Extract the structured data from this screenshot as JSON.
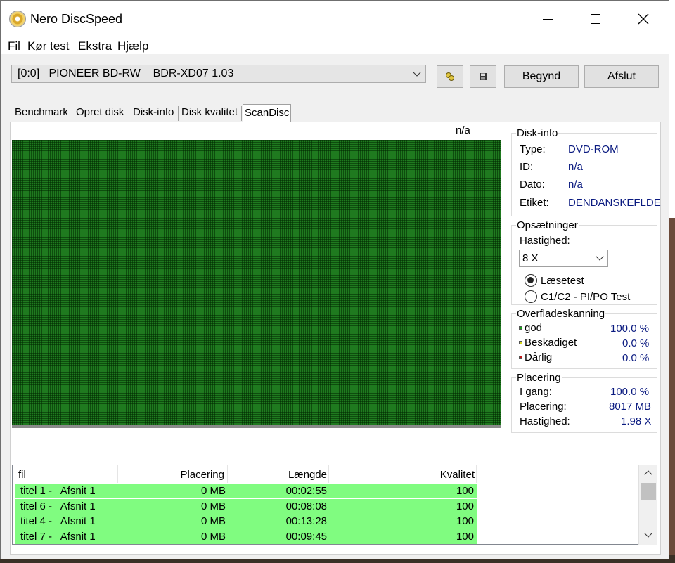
{
  "window": {
    "title": "Nero DiscSpeed",
    "controls": {
      "minimize": "minimize-icon",
      "maximize": "maximize-icon",
      "close": "close-icon"
    }
  },
  "menu": [
    "Fil",
    "Kør test",
    "Ekstra",
    "Hjælp"
  ],
  "toolbar": {
    "drive": "[0:0]   PIONEER BD-RW    BDR-XD07 1.03",
    "start_label": "Begynd",
    "exit_label": "Afslut"
  },
  "tabs": [
    "Benchmark",
    "Opret disk",
    "Disk-info",
    "Disk kvalitet",
    "ScanDisc"
  ],
  "active_tab": "ScanDisc",
  "scan": {
    "top_label": "n/a"
  },
  "disk_info": {
    "title": "Disk-info",
    "rows": [
      {
        "label": "Type:",
        "value": "DVD-ROM"
      },
      {
        "label": "ID:",
        "value": "n/a"
      },
      {
        "label": "Dato:",
        "value": "n/a"
      },
      {
        "label": "Etiket:",
        "value": "DENDANSKEFLDE"
      }
    ]
  },
  "settings": {
    "title": "Opsætninger",
    "speed_label": "Hastighed:",
    "speed_value": "8 X",
    "radio_read": "Læsetest",
    "radio_c1c2": "C1/C2 - PI/PO Test",
    "selected": "read"
  },
  "surface": {
    "title": "Overfladeskanning",
    "rows": [
      {
        "label": "god",
        "value": "100.0 %",
        "color": "#1fa01f"
      },
      {
        "label": "Beskadiget",
        "value": "0.0 %",
        "color": "#d8d820"
      },
      {
        "label": "Dårlig",
        "value": "0.0 %",
        "color": "#c01818"
      }
    ]
  },
  "position": {
    "title": "Placering",
    "rows": [
      {
        "label": "I gang:",
        "value": "100.0 %"
      },
      {
        "label": "Placering:",
        "value": "8017 MB"
      },
      {
        "label": "Hastighed:",
        "value": "1.98 X"
      }
    ]
  },
  "table": {
    "headers": [
      "fil",
      "Placering",
      "Længde",
      "Kvalitet"
    ],
    "rows": [
      {
        "fil": "titel 1 -   Afsnit 1",
        "placering": "0 MB",
        "laengde": "00:02:55",
        "kvalitet": "100"
      },
      {
        "fil": "titel 6 -   Afsnit 1",
        "placering": "0 MB",
        "laengde": "00:08:08",
        "kvalitet": "100"
      },
      {
        "fil": "titel 4 -   Afsnit 1",
        "placering": "0 MB",
        "laengde": "00:13:28",
        "kvalitet": "100"
      },
      {
        "fil": "titel 7 -   Afsnit 1",
        "placering": "0 MB",
        "laengde": "00:09:45",
        "kvalitet": "100"
      }
    ],
    "row_color": "#80fc80"
  }
}
